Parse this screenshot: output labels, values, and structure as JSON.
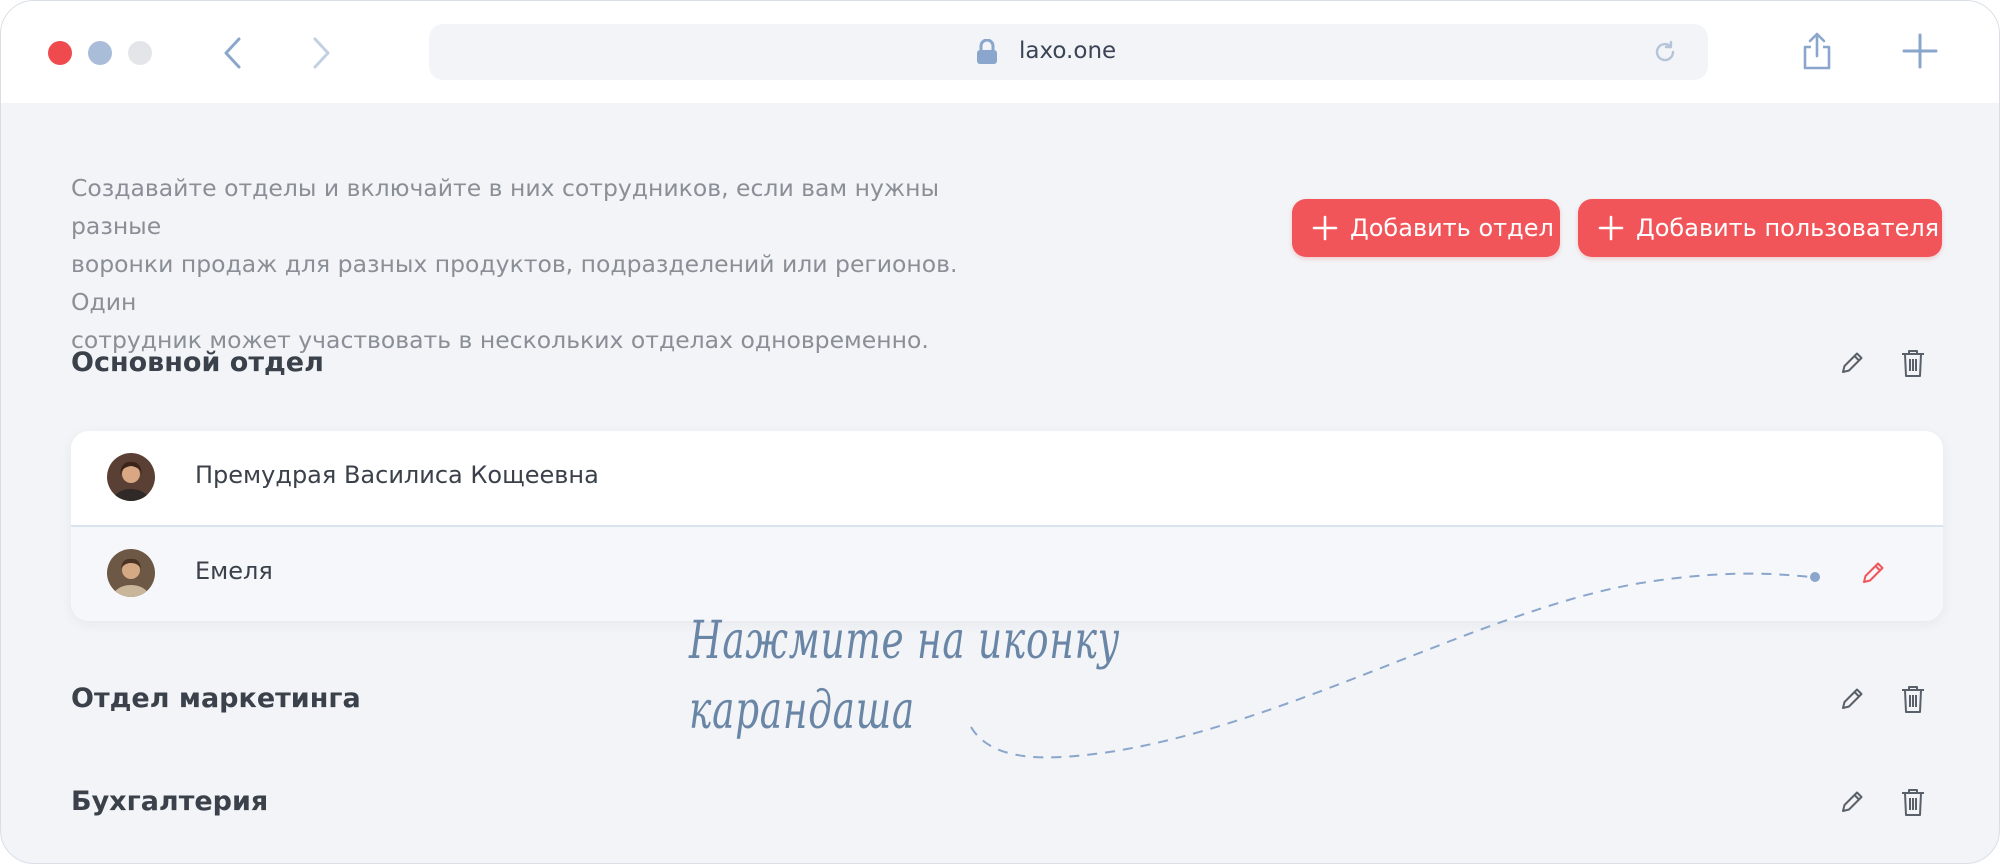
{
  "browser": {
    "url": "laxo.one",
    "icons": [
      "close-light",
      "minimize-light",
      "zoom-light",
      "back-icon",
      "forward-icon",
      "lock-icon",
      "reload-icon",
      "share-icon",
      "new-tab-icon"
    ]
  },
  "page": {
    "intro_lines": [
      "Создавайте отделы и включайте в них сотрудников, если вам нужны разные",
      "воронки продаж для разных продуктов, подразделений или регионов. Один",
      "сотрудник может участвовать в нескольких отделах одновременно."
    ],
    "add_department_label": "Добавить отдел",
    "add_user_label": "Добавить пользователя",
    "departments": [
      {
        "title": "Основной отдел",
        "members": [
          "Премудрая Василиса Кощеевна",
          "Емеля"
        ]
      },
      {
        "title": "Отдел маркетинга"
      },
      {
        "title": "Бухгалтерия"
      }
    ],
    "hint_lines": [
      "Нажмите на иконку",
      "карандаша"
    ]
  },
  "colors": {
    "accent": "#f1555a",
    "background": "#f2f4f7",
    "text": "#3b414b",
    "muted": "#8a8f97",
    "hint": "#6a86a6"
  }
}
